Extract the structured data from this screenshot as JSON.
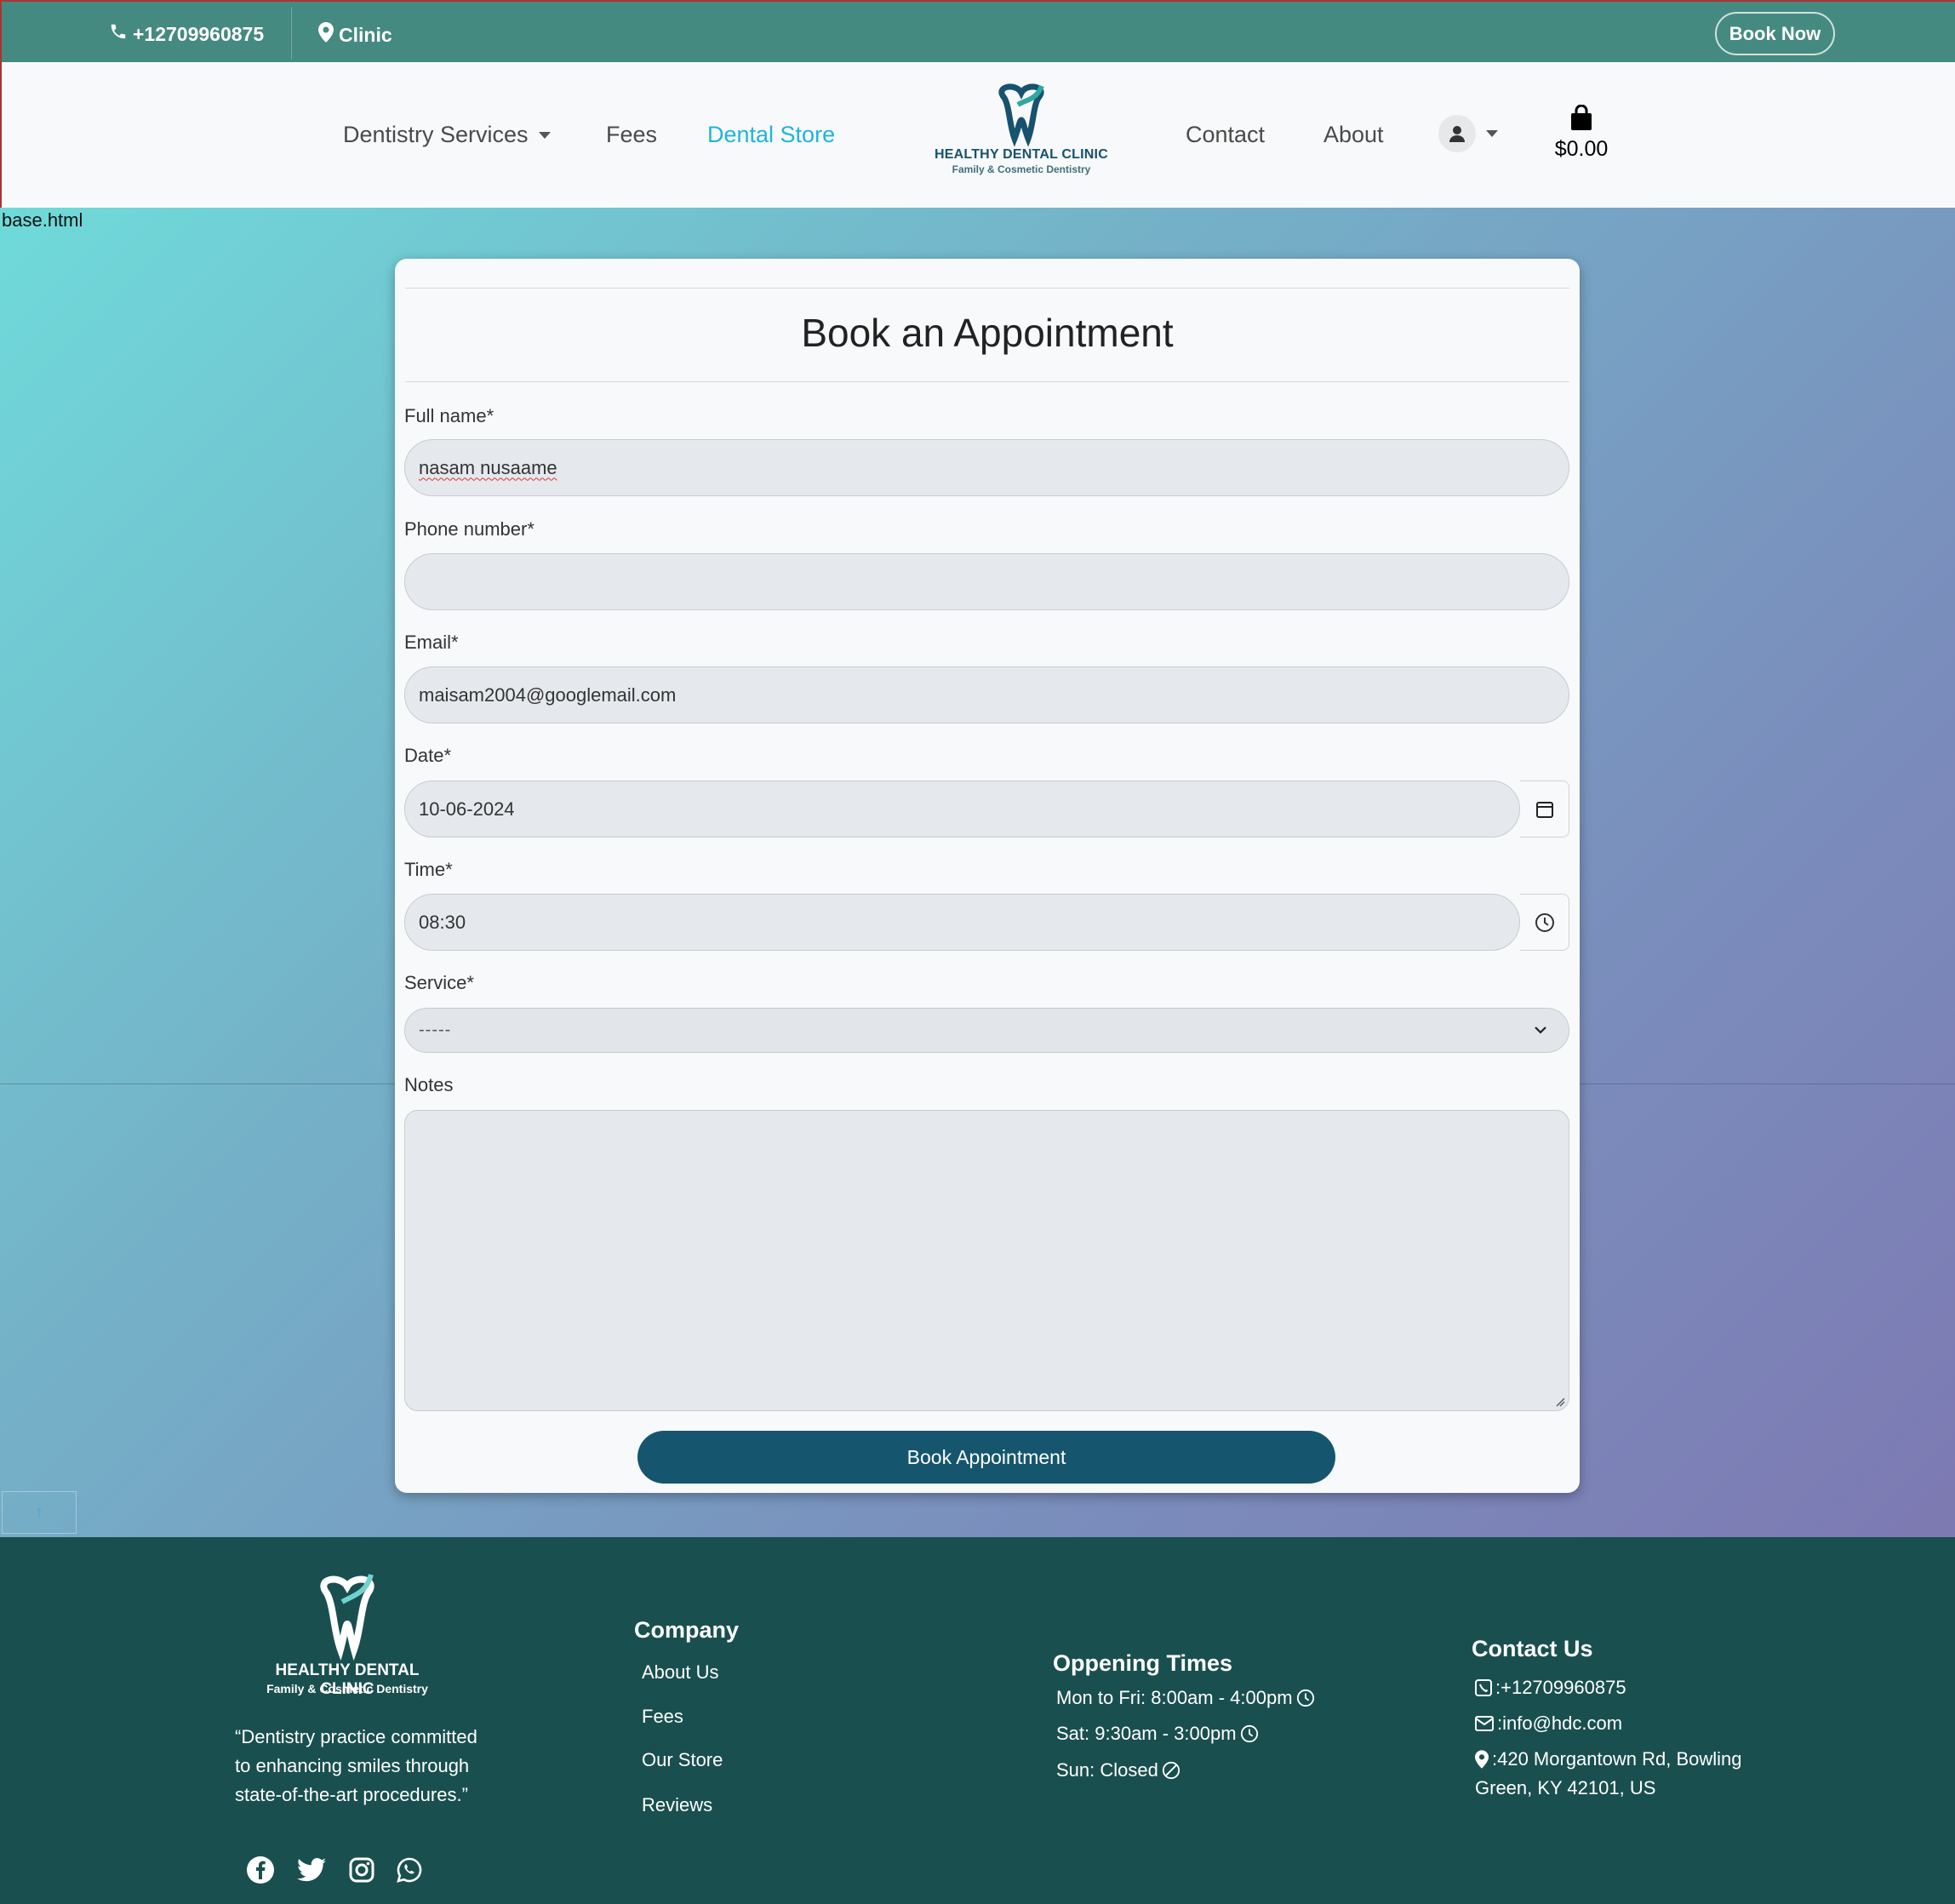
{
  "topbar": {
    "phone": "+12709960875",
    "location": "Clinic",
    "book_now": "Book Now"
  },
  "nav": {
    "services": "Dentistry Services",
    "fees": "Fees",
    "store": "Dental Store",
    "contact": "Contact",
    "about": "About",
    "logo_title": "HEALTHY DENTAL CLINIC",
    "logo_subtitle": "Family & Cosmetic Dentistry",
    "cart_total": "$0.00"
  },
  "page": {
    "debug_label": "base.html"
  },
  "form": {
    "title": "Book an Appointment",
    "full_name_label": "Full name*",
    "full_name_value": "nasam nusaame",
    "phone_label": "Phone number*",
    "phone_value": "",
    "email_label": "Email*",
    "email_value": "maisam2004@googlemail.com",
    "date_label": "Date*",
    "date_value": "10-06-2024",
    "time_label": "Time*",
    "time_value": "08:30",
    "service_label": "Service*",
    "service_value": "-----",
    "notes_label": "Notes",
    "notes_value": "",
    "submit": "Book Appointment"
  },
  "footer": {
    "logo_title": "HEALTHY DENTAL CLINIC",
    "logo_subtitle": "Family & Cosmetic Dentistry",
    "quote": "“Dentistry practice committed to enhancing smiles through state-of-the-art procedures.”",
    "company_heading": "Company",
    "company_links": [
      "About Us",
      "Fees",
      "Our Store",
      "Reviews"
    ],
    "hours_heading": "Oppening Times",
    "hours": [
      "Mon to Fri: 8:00am - 4:00pm",
      "Sat: 9:30am - 3:00pm",
      "Sun: Closed"
    ],
    "contact_heading": "Contact Us",
    "contact_phone": ":+12709960875",
    "contact_email": ":info@hdc.com",
    "contact_address_1": ":420 Morgantown Rd, Bowling",
    "contact_address_2": "Green, KY 42101, US",
    "socials": [
      "facebook-icon",
      "twitter-icon",
      "instagram-icon",
      "whatsapp-icon"
    ]
  },
  "colors": {
    "topbar": "#458a80",
    "accent": "#1fb5d6",
    "button": "#15566e",
    "footer": "#1a4f4f"
  }
}
